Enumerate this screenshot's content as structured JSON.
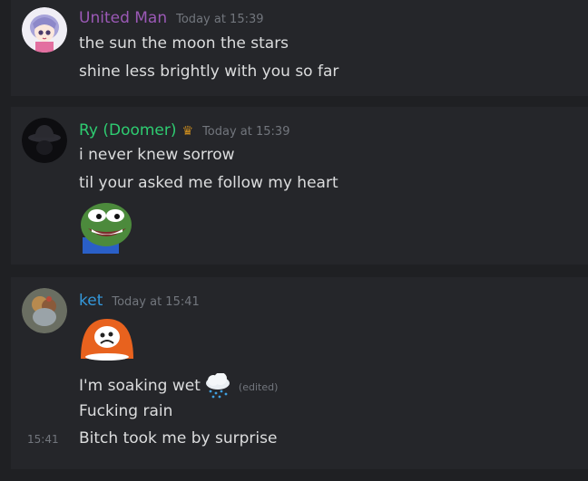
{
  "messages": [
    {
      "username": "United Man",
      "user_color": "#9b59b6",
      "timestamp": "Today at 15:39",
      "lines": [
        "the sun the moon the stars",
        "shine less brightly with you so far"
      ]
    },
    {
      "username": "Ry (Doomer)",
      "user_color": "#2ecc71",
      "timestamp": "Today at 15:39",
      "badge_icon": "crown-icon",
      "lines": [
        "i never knew sorrow",
        "til your asked me follow my heart"
      ],
      "emote": "pepe-smile-emote"
    },
    {
      "username": "ket",
      "user_color": "#3498db",
      "timestamp": "Today at 15:41",
      "emote": "orange-face-emote",
      "lines": [
        "I'm soaking wet",
        "Fucking rain",
        "Bitch took me by surprise"
      ],
      "inline_emoji": "rain-cloud-emoji",
      "edited_label": "(edited)",
      "side_timestamp": "15:41"
    }
  ]
}
